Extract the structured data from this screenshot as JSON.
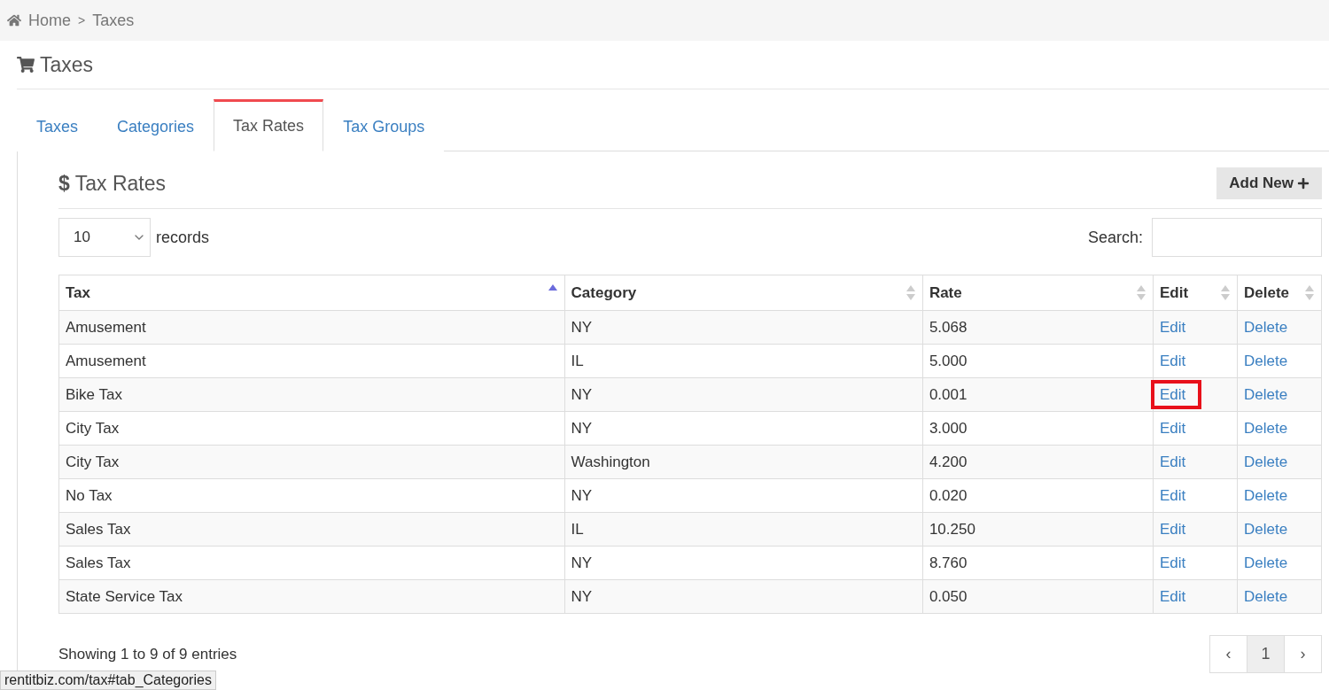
{
  "breadcrumb": {
    "items": [
      "Home",
      "Taxes"
    ],
    "separator": ">"
  },
  "page_title": "Taxes",
  "tabs": [
    {
      "label": "Taxes",
      "selected": false
    },
    {
      "label": "Categories",
      "selected": false
    },
    {
      "label": "Tax Rates",
      "selected": true
    },
    {
      "label": "Tax Groups",
      "selected": false
    }
  ],
  "panel": {
    "currency_symbol": "$",
    "title": "Tax Rates",
    "add_button": "Add New"
  },
  "length_menu": {
    "value": "10",
    "label": "records"
  },
  "search": {
    "label": "Search:"
  },
  "table": {
    "columns": [
      {
        "label": "Tax",
        "sorted": true
      },
      {
        "label": "Category",
        "sorted": false
      },
      {
        "label": "Rate",
        "sorted": false
      },
      {
        "label": "Edit",
        "sorted": false
      },
      {
        "label": "Delete",
        "sorted": false
      }
    ],
    "rows": [
      {
        "tax": "Amusement",
        "category": "NY",
        "rate": "5.068",
        "edit": "Edit",
        "delete": "Delete",
        "highlighted": false
      },
      {
        "tax": "Amusement",
        "category": "IL",
        "rate": "5.000",
        "edit": "Edit",
        "delete": "Delete",
        "highlighted": false
      },
      {
        "tax": "Bike Tax",
        "category": "NY",
        "rate": "0.001",
        "edit": "Edit",
        "delete": "Delete",
        "highlighted": true
      },
      {
        "tax": "City Tax",
        "category": "NY",
        "rate": "3.000",
        "edit": "Edit",
        "delete": "Delete",
        "highlighted": false
      },
      {
        "tax": "City Tax",
        "category": "Washington",
        "rate": "4.200",
        "edit": "Edit",
        "delete": "Delete",
        "highlighted": false
      },
      {
        "tax": "No Tax",
        "category": "NY",
        "rate": "0.020",
        "edit": "Edit",
        "delete": "Delete",
        "highlighted": false
      },
      {
        "tax": "Sales Tax",
        "category": "IL",
        "rate": "10.250",
        "edit": "Edit",
        "delete": "Delete",
        "highlighted": false
      },
      {
        "tax": "Sales Tax",
        "category": "NY",
        "rate": "8.760",
        "edit": "Edit",
        "delete": "Delete",
        "highlighted": false
      },
      {
        "tax": "State Service Tax",
        "category": "NY",
        "rate": "0.050",
        "edit": "Edit",
        "delete": "Delete",
        "highlighted": false
      }
    ]
  },
  "info": "Showing 1 to 9 of 9 entries",
  "pagination": [
    {
      "label": "‹",
      "selected": false
    },
    {
      "label": "1",
      "selected": true
    },
    {
      "label": "›",
      "selected": false
    }
  ],
  "status_url": "rentitbiz.com/tax#tab_Categories"
}
